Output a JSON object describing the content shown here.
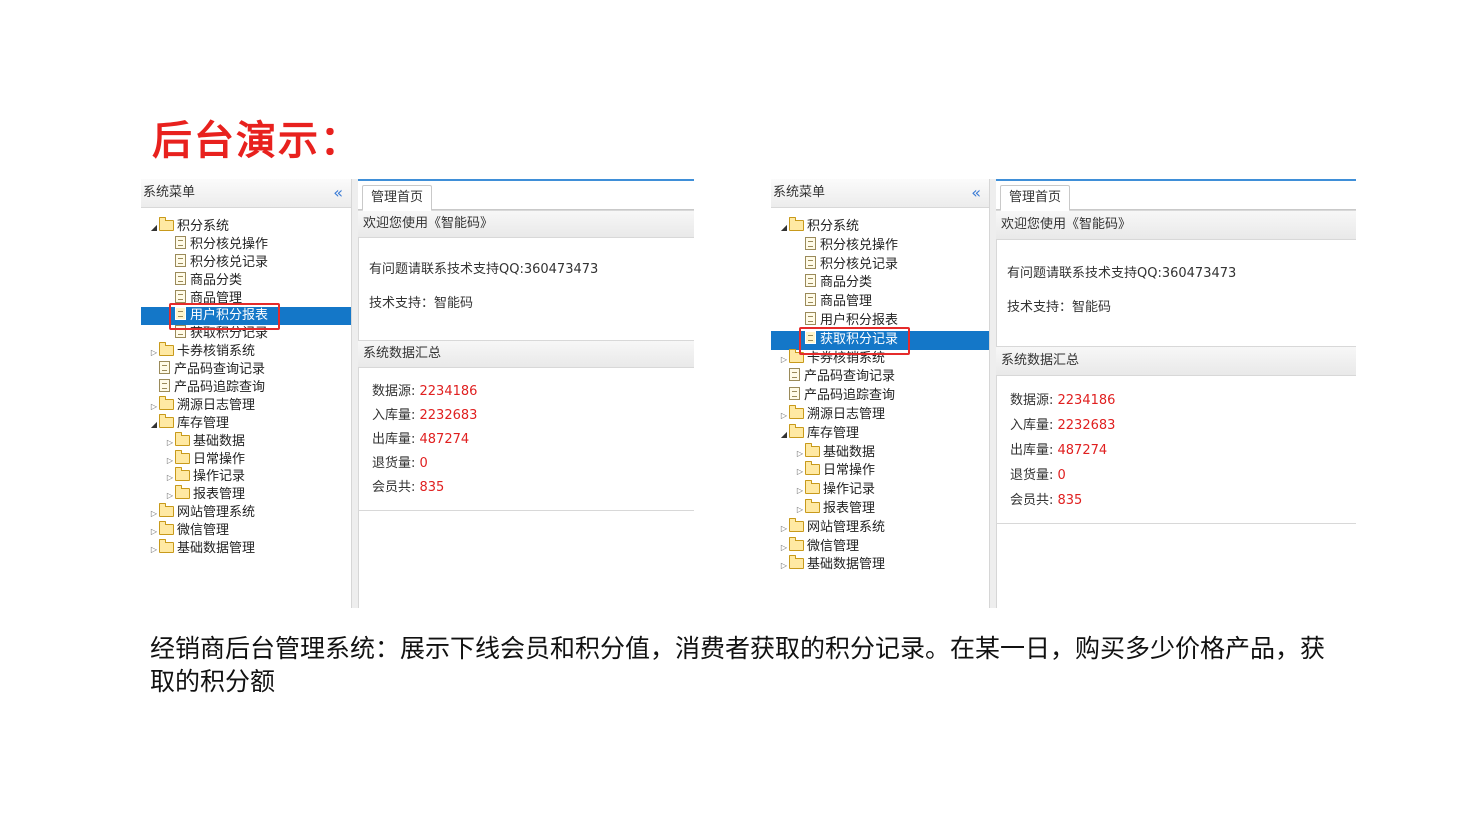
{
  "slide": {
    "title": "后台演示：",
    "caption": "经销商后台管理系统：展示下线会员和积分值，消费者获取的积分记录。在某一日，购买多少价格产品，获取的积分额"
  },
  "sidebar": {
    "title": "系统菜单",
    "collapse_icon": "«",
    "items": [
      {
        "label": "积分系统",
        "level": 0,
        "type": "folder",
        "state": "open"
      },
      {
        "label": "积分核兑操作",
        "level": 1,
        "type": "file"
      },
      {
        "label": "积分核兑记录",
        "level": 1,
        "type": "file"
      },
      {
        "label": "商品分类",
        "level": 1,
        "type": "file"
      },
      {
        "label": "商品管理",
        "level": 1,
        "type": "file"
      },
      {
        "label": "用户积分报表",
        "level": 1,
        "type": "file"
      },
      {
        "label": "获取积分记录",
        "level": 1,
        "type": "file"
      },
      {
        "label": "卡券核销系统",
        "level": 0,
        "type": "folder",
        "state": "closed"
      },
      {
        "label": "产品码查询记录",
        "level": 0,
        "type": "file"
      },
      {
        "label": "产品码追踪查询",
        "level": 0,
        "type": "file"
      },
      {
        "label": "溯源日志管理",
        "level": 0,
        "type": "folder",
        "state": "closed"
      },
      {
        "label": "库存管理",
        "level": 0,
        "type": "folder",
        "state": "open"
      },
      {
        "label": "基础数据",
        "level": 1,
        "type": "folder",
        "state": "closed"
      },
      {
        "label": "日常操作",
        "level": 1,
        "type": "folder",
        "state": "closed"
      },
      {
        "label": "操作记录",
        "level": 1,
        "type": "folder",
        "state": "closed"
      },
      {
        "label": "报表管理",
        "level": 1,
        "type": "folder",
        "state": "closed"
      },
      {
        "label": "网站管理系统",
        "level": 0,
        "type": "folder",
        "state": "closed"
      },
      {
        "label": "微信管理",
        "level": 0,
        "type": "folder",
        "state": "closed"
      },
      {
        "label": "基础数据管理",
        "level": 0,
        "type": "folder",
        "state": "closed"
      }
    ]
  },
  "screens": [
    {
      "selected_index": 5
    },
    {
      "selected_index": 6
    }
  ],
  "main": {
    "tab_label": "管理首页",
    "welcome_title": "欢迎您使用《智能码》",
    "support_line": "有问题请联系技术支持QQ:360473473",
    "tech_line": "技术支持：智能码",
    "stats_title": "系统数据汇总",
    "stats": [
      {
        "label": "数据源: ",
        "value": "2234186"
      },
      {
        "label": "入库量: ",
        "value": "2232683"
      },
      {
        "label": "出库量: ",
        "value": "487274"
      },
      {
        "label": "退货量: ",
        "value": "0"
      },
      {
        "label": "会员共: ",
        "value": "835"
      }
    ]
  },
  "colors": {
    "title_red": "#e8211e",
    "selected_blue": "#1477c8",
    "value_red": "#e02020",
    "highlight_red": "#e52b2b"
  }
}
